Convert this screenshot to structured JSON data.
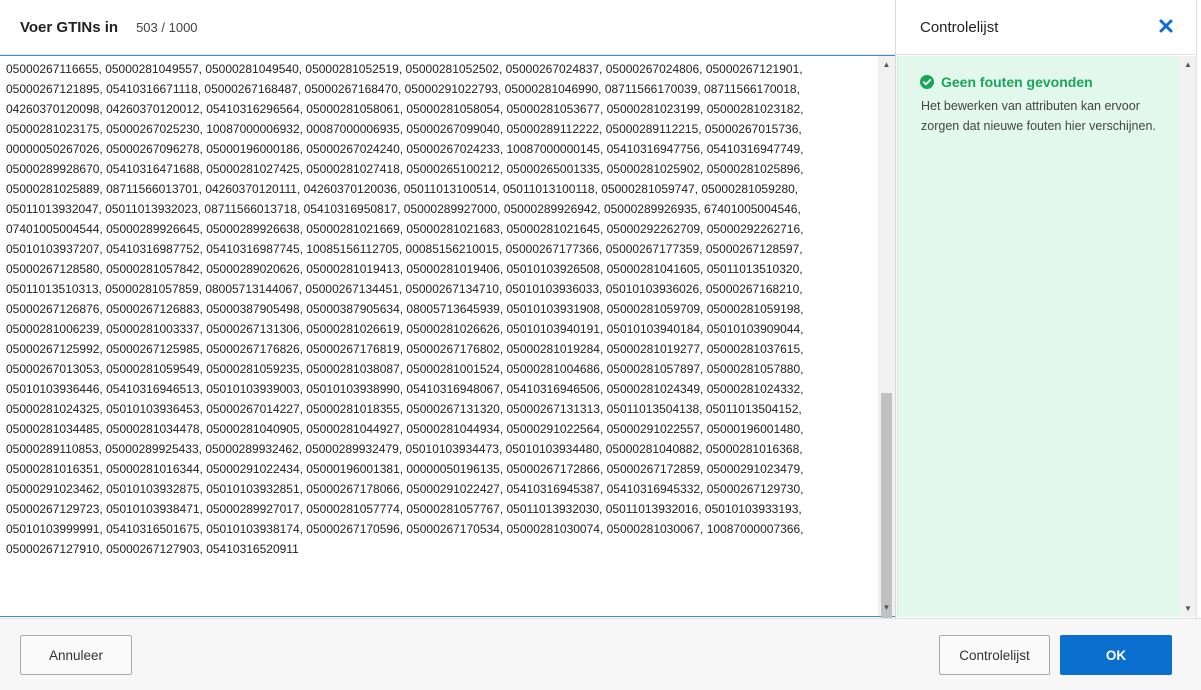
{
  "dialog": {
    "title": "Voer GTINs in",
    "counter": "503 / 1000"
  },
  "gtins": {
    "text": "05000267116655, 05000281049557, 05000281049540, 05000281052519, 05000281052502, 05000267024837, 05000267024806, 05000267121901, 05000267121895, 05410316671118, 05000267168487, 05000267168470, 05000291022793, 05000281046990, 08711566170039, 08711566170018, 04260370120098, 04260370120012, 05410316296564, 05000281058061, 05000281058054, 05000281053677, 05000281023199, 05000281023182, 05000281023175, 05000267025230, 10087000006932, 00087000006935, 05000267099040, 05000289112222, 05000289112215, 05000267015736, 00000050267026, 05000267096278, 05000196000186, 05000267024240, 05000267024233, 10087000000145, 05410316947756, 05410316947749, 05000289928670, 05410316471688, 05000281027425, 05000281027418, 05000265100212, 05000265001335, 05000281025902, 05000281025896, 05000281025889, 08711566013701, 04260370120111, 04260370120036, 05011013100514, 05011013100118, 05000281059747, 05000281059280, 05011013932047, 05011013932023, 08711566013718, 05410316950817, 05000289927000, 05000289926942, 05000289926935, 67401005004546, 07401005004544, 05000289926645, 05000289926638, 05000281021669, 05000281021683, 05000281021645, 05000292262709, 05000292262716, 05010103937207, 05410316987752, 05410316987745, 10085156112705, 00085156210015, 05000267177366, 05000267177359, 05000267128597, 05000267128580, 05000281057842, 05000289020626, 05000281019413, 05000281019406, 05010103926508, 05000281041605, 05011013510320, 05011013510313, 05000281057859, 08005713144067, 05000267134451, 05000267134710, 05010103936033, 05010103936026, 05000267168210, 05000267126876, 05000267126883, 05000387905498, 05000387905634, 08005713645939, 05010103931908, 05000281059709, 05000281059198, 05000281006239, 05000281003337, 05000267131306, 05000281026619, 05000281026626, 05010103940191, 05010103940184, 05010103909044, 05000267125992, 05000267125985, 05000267176826, 05000267176819, 05000267176802, 05000281019284, 05000281019277, 05000281037615, 05000267013053, 05000281059549, 05000281059235, 05000281038087, 05000281001524, 05000281004686, 05000281057897, 05000281057880, 05010103936446, 05410316946513, 05010103939003, 05010103938990, 05410316948067, 05410316946506, 05000281024349, 05000281024332, 05000281024325, 05010103936453, 05000267014227, 05000281018355, 05000267131320, 05000267131313, 05011013504138, 05011013504152, 05000281034485, 05000281034478, 05000281040905, 05000281044927, 05000281044934, 05000291022564, 05000291022557, 05000196001480, 05000289110853, 05000289925433, 05000289932462, 05000289932479, 05010103934473, 05010103934480, 05000281040882, 05000281016368, 05000281016351, 05000281016344, 05000291022434, 05000196001381, 00000050196135, 05000267172866, 05000267172859, 05000291023479, 05000291023462, 05010103932875, 05010103932851, 05000267178066, 05000291022427, 05410316945387, 05410316945332, 05000267129730, 05000267129723, 05010103938471, 05000289927017, 05000281057774, 05000281057767, 05011013932030, 05011013932016, 05010103933193, 05010103999991, 05410316501675, 05010103938174, 05000267170596, 05000267170534, 05000281030074, 05000281030067, 10087000007366, 05000267127910, 05000267127903, 05410316520911"
  },
  "checklist": {
    "title": "Controlelijst",
    "status_label": "Geen fouten gevonden",
    "status_color": "#1aa55a",
    "description": "Het bewerken van attributen kan ervoor zorgen dat nieuwe fouten hier verschijnen.",
    "close_icon": "close-x-icon",
    "check_icon": "check-circle-icon"
  },
  "footer": {
    "cancel_label": "Annuleer",
    "checklist_label": "Controlelijst",
    "ok_label": "OK",
    "ok_color": "#0a6fce"
  }
}
